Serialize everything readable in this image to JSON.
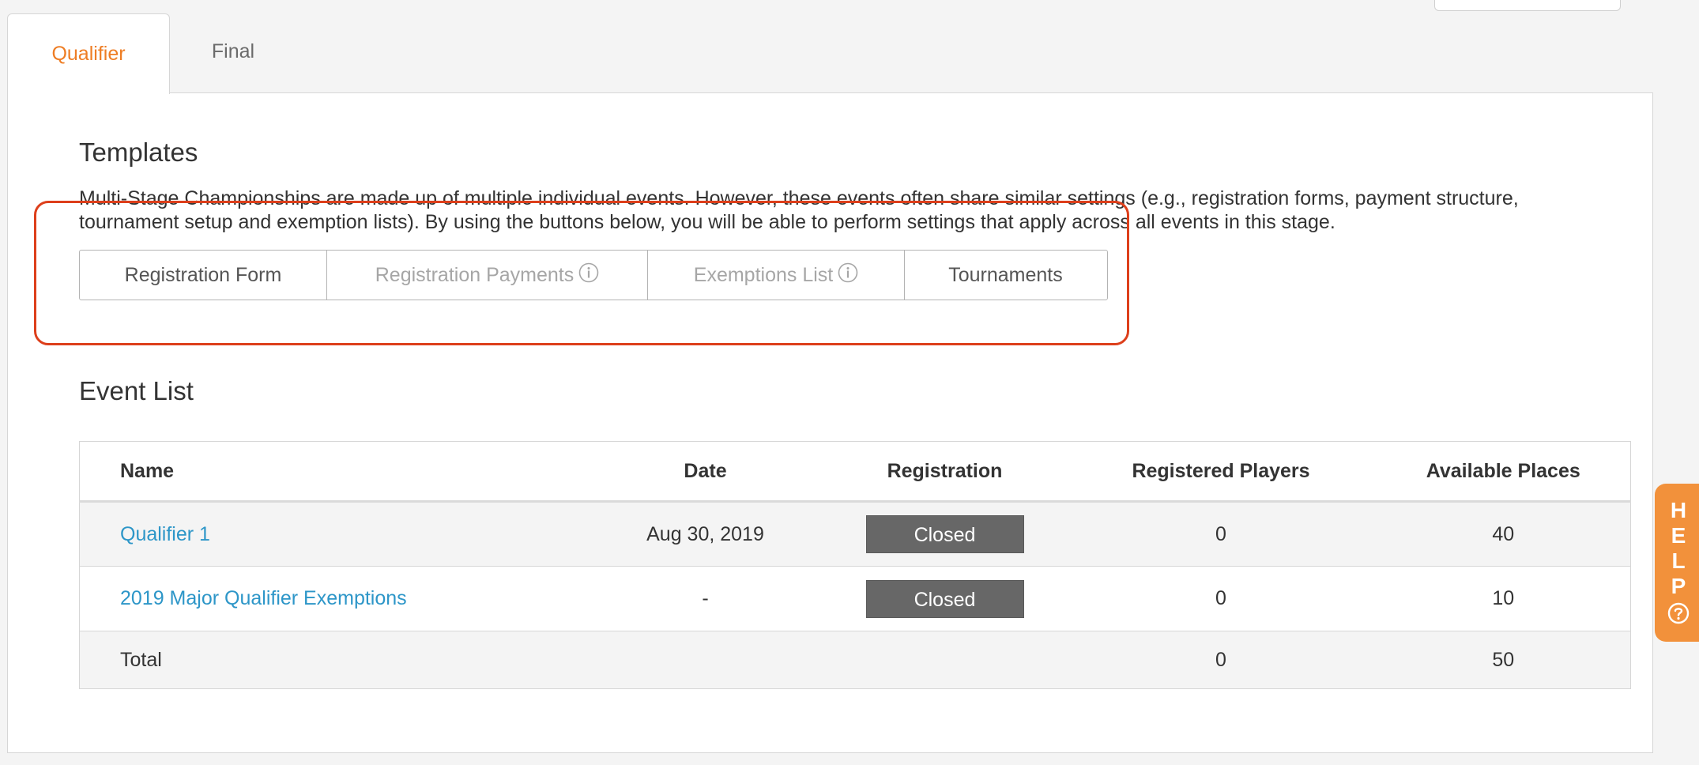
{
  "tabs": [
    {
      "label": "Qualifier",
      "active": true
    },
    {
      "label": "Final",
      "active": false
    }
  ],
  "templates": {
    "title": "Templates",
    "description": "Multi-Stage Championships are made up of multiple individual events. However, these events often share similar settings (e.g., registration forms, payment structure, tournament setup and exemption lists). By using the buttons below, you will be able to perform settings that apply across all events in this stage.",
    "buttons": [
      {
        "label": "Registration Form",
        "enabled": true,
        "info": false
      },
      {
        "label": "Registration Payments",
        "enabled": false,
        "info": true
      },
      {
        "label": "Exemptions List",
        "enabled": false,
        "info": true
      },
      {
        "label": "Tournaments",
        "enabled": true,
        "info": false
      }
    ]
  },
  "event_list": {
    "title": "Event List",
    "columns": [
      "Name",
      "Date",
      "Registration",
      "Registered Players",
      "Available Places"
    ],
    "rows": [
      {
        "name": "Qualifier 1",
        "date": "Aug 30, 2019",
        "registration": "Closed",
        "registered_players": "0",
        "available_places": "40"
      },
      {
        "name": "2019 Major Qualifier Exemptions",
        "date": "-",
        "registration": "Closed",
        "registered_players": "0",
        "available_places": "10"
      }
    ],
    "total": {
      "label": "Total",
      "registered_players": "0",
      "available_places": "50"
    }
  },
  "help": {
    "letters": [
      "H",
      "E",
      "L",
      "P"
    ],
    "icon": "question-circle-icon"
  },
  "colors": {
    "accent": "#ee7d24",
    "link": "#2d96c8",
    "highlight": "#dd3f1b",
    "badge": "#676767",
    "help": "#f2913b"
  }
}
